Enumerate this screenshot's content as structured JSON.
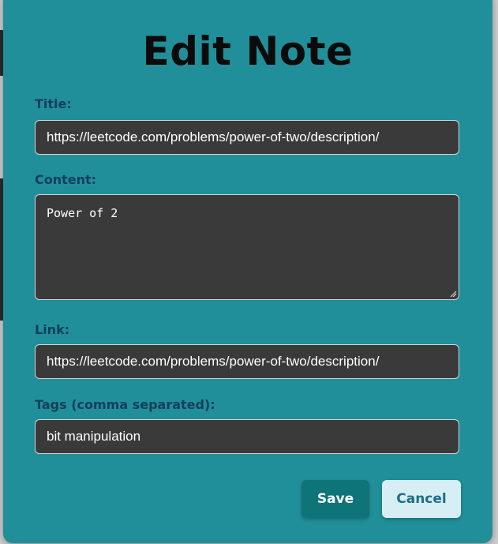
{
  "modal": {
    "title": "Edit Note",
    "fields": {
      "title": {
        "label": "Title:",
        "value": "https://leetcode.com/problems/power-of-two/description/"
      },
      "content": {
        "label": "Content:",
        "value": "Power of 2"
      },
      "link": {
        "label": "Link:",
        "value": "https://leetcode.com/problems/power-of-two/description/"
      },
      "tags": {
        "label": "Tags (comma separated):",
        "value": "bit manipulation"
      }
    },
    "buttons": {
      "save": "Save",
      "cancel": "Cancel"
    }
  },
  "colors": {
    "modal_bg": "#218f99",
    "field_bg": "#3a3a3a",
    "label": "#123f5a",
    "save_bg": "#0e7478",
    "cancel_bg": "#d6eef4",
    "cancel_text": "#1a6f86"
  },
  "icons": {
    "resize": "resize-grip-icon"
  }
}
